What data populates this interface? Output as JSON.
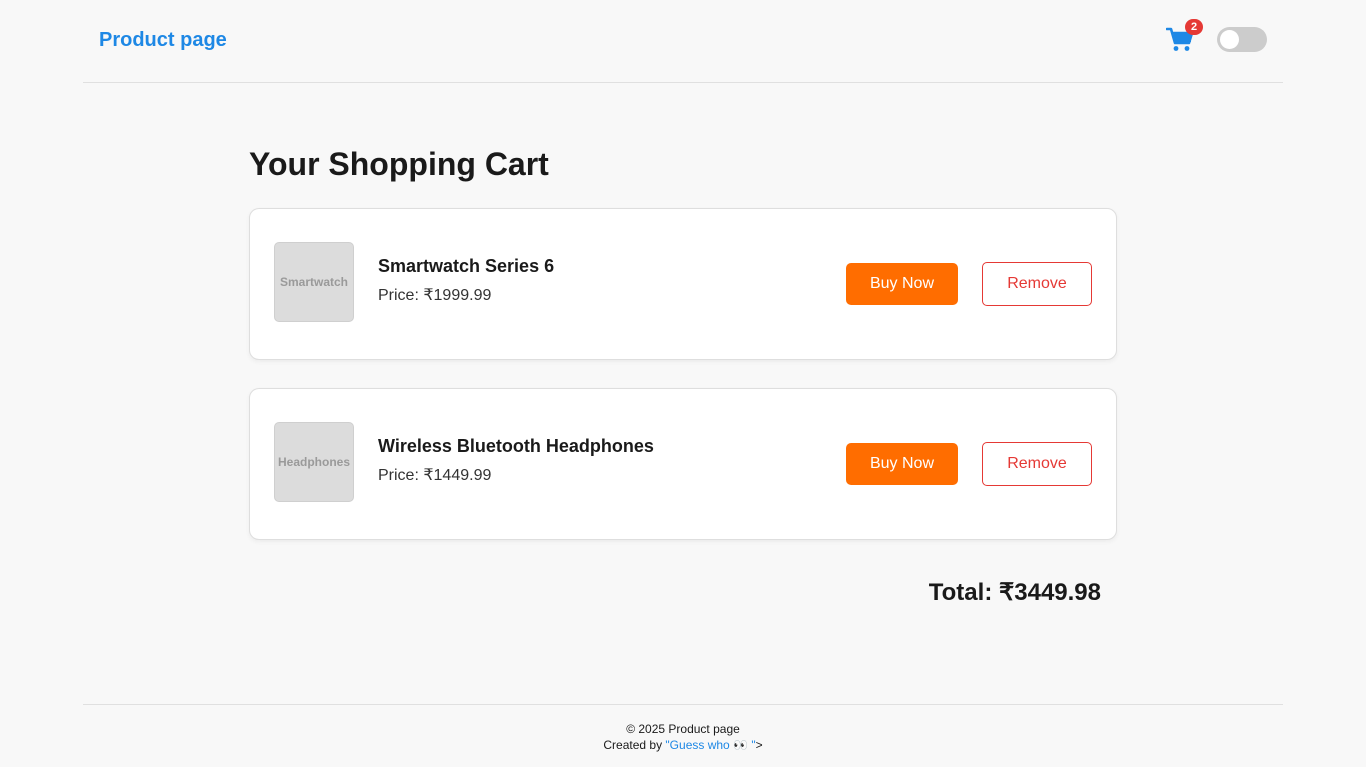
{
  "header": {
    "brand": "Product page",
    "cart_count": "2",
    "icons": {
      "cart": "shopping-cart-icon",
      "toggle": "theme-toggle"
    }
  },
  "main": {
    "title": "Your Shopping Cart",
    "items": [
      {
        "name": "Smartwatch Series 6",
        "price": "Price: ₹1999.99",
        "image_alt": "Smartwatch",
        "buy_label": "Buy Now",
        "remove_label": "Remove"
      },
      {
        "name": "Wireless Bluetooth Headphones",
        "price": "Price: ₹1449.99",
        "image_alt": "Headphones",
        "buy_label": "Buy Now",
        "remove_label": "Remove"
      }
    ],
    "total": "Total: ₹3449.98"
  },
  "footer": {
    "copyright": "© 2025 Product page",
    "created_by": "Created by ",
    "author_link": "\"Guess who 👀 \"",
    "trailing": ">"
  },
  "colors": {
    "accent": "#1e88e5",
    "buy": "#ff6d00",
    "remove": "#e53935",
    "badge": "#e53935",
    "background": "#f8f8f8"
  }
}
